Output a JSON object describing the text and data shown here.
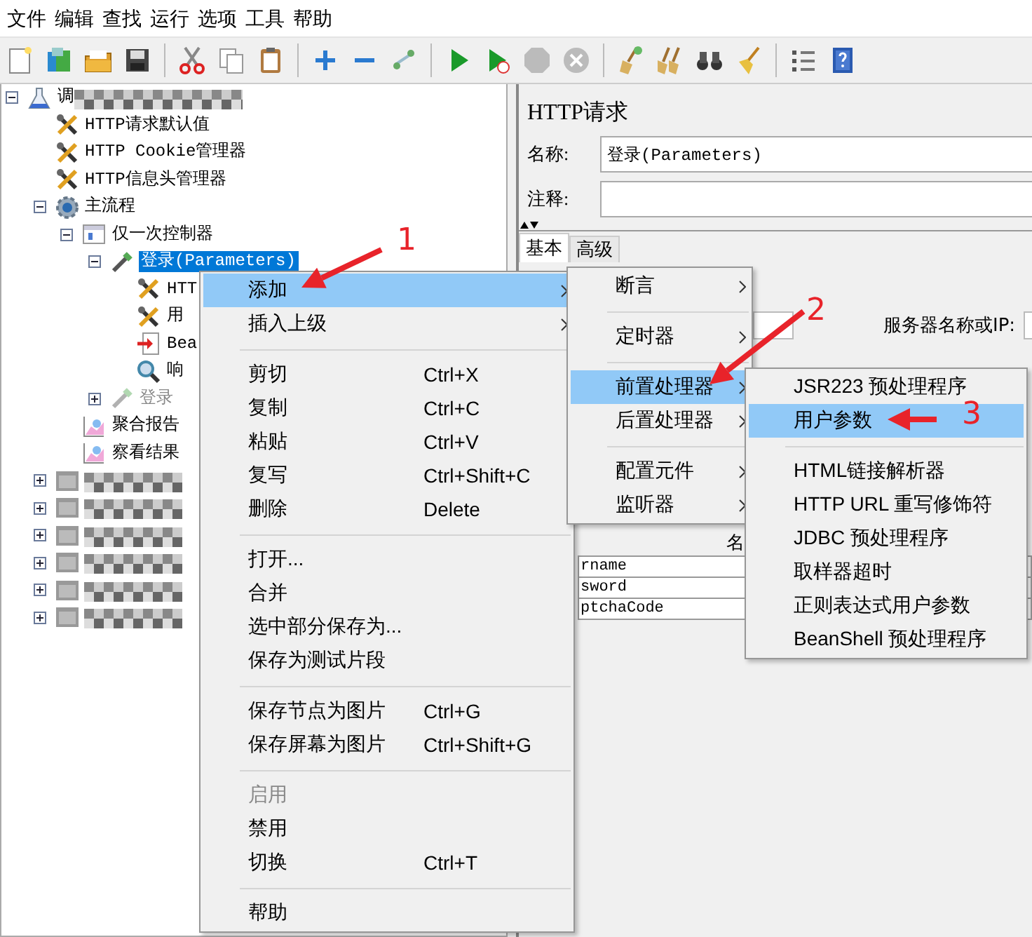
{
  "menu_bar": [
    "文件",
    "编辑",
    "查找",
    "运行",
    "选项",
    "工具",
    "帮助"
  ],
  "tree": [
    {
      "label": "调",
      "kind": "test-plan",
      "redacted": true,
      "expanded": true,
      "selected": false,
      "disabled": false,
      "children": [
        {
          "label": "HTTP请求默认值",
          "kind": "config",
          "redacted": false,
          "selected": false,
          "disabled": false
        },
        {
          "label": "HTTP Cookie管理器",
          "kind": "config",
          "redacted": false,
          "selected": false,
          "disabled": false
        },
        {
          "label": "HTTP信息头管理器",
          "kind": "config",
          "redacted": false,
          "selected": false,
          "disabled": false
        },
        {
          "label": "主流程",
          "kind": "thread-group",
          "redacted": false,
          "expanded": true,
          "selected": false,
          "disabled": false,
          "children": [
            {
              "label": "仅一次控制器",
              "kind": "controller",
              "redacted": false,
              "expanded": true,
              "selected": false,
              "disabled": false,
              "children": [
                {
                  "label": "登录(Parameters)",
                  "kind": "sampler",
                  "redacted": false,
                  "expanded": true,
                  "selected": true,
                  "disabled": false,
                  "children": [
                    {
                      "label": "HTT",
                      "kind": "config",
                      "redacted": false,
                      "selected": false,
                      "disabled": false
                    },
                    {
                      "label": "用",
                      "kind": "config",
                      "redacted": false,
                      "selected": false,
                      "disabled": false
                    },
                    {
                      "label": "Bea",
                      "kind": "postprocessor",
                      "redacted": false,
                      "selected": false,
                      "disabled": false
                    },
                    {
                      "label": "响",
                      "kind": "listener",
                      "redacted": false,
                      "selected": false,
                      "disabled": false
                    }
                  ]
                },
                {
                  "label": "登录",
                  "kind": "sampler",
                  "redacted": false,
                  "expanded": false,
                  "selected": false,
                  "disabled": true
                }
              ]
            },
            {
              "label": "聚合报告",
              "kind": "report",
              "redacted": false,
              "selected": false,
              "disabled": false
            },
            {
              "label": "察看结果",
              "kind": "report",
              "redacted": false,
              "selected": false,
              "disabled": false
            }
          ]
        },
        {
          "kind": "controller",
          "redacted": true,
          "expanded": false,
          "selected": false,
          "disabled": false
        },
        {
          "kind": "controller",
          "redacted": true,
          "expanded": false,
          "selected": false,
          "disabled": false
        },
        {
          "kind": "controller",
          "redacted": true,
          "expanded": false,
          "selected": false,
          "disabled": false
        },
        {
          "kind": "controller",
          "redacted": true,
          "expanded": false,
          "selected": false,
          "disabled": false
        },
        {
          "kind": "controller",
          "redacted": true,
          "expanded": false,
          "selected": false,
          "disabled": false
        },
        {
          "kind": "controller",
          "redacted": true,
          "expanded": false,
          "selected": false,
          "disabled": false
        }
      ]
    }
  ],
  "detail": {
    "title": "HTTP请求",
    "name_label": "名称:",
    "name_value": "登录(Parameters)",
    "comment_label": "注释:",
    "tabs": [
      {
        "label": "基本",
        "selected": true
      },
      {
        "label": "高级",
        "selected": false
      }
    ],
    "server_label": "服务器名称或IP:",
    "table": {
      "header": "名",
      "rows": [
        "rname",
        "sword",
        "ptchaCode"
      ]
    }
  },
  "context_menu": {
    "items": [
      {
        "kind": "item",
        "label": "添加",
        "submenu": true,
        "selected": true,
        "disabled": false
      },
      {
        "kind": "item",
        "label": "插入上级",
        "submenu": true,
        "selected": false,
        "disabled": false
      },
      {
        "kind": "separator"
      },
      {
        "kind": "item",
        "label": "剪切",
        "shortcut": "Ctrl+X",
        "submenu": false,
        "selected": false,
        "disabled": false
      },
      {
        "kind": "item",
        "label": "复制",
        "shortcut": "Ctrl+C",
        "submenu": false,
        "selected": false,
        "disabled": false
      },
      {
        "kind": "item",
        "label": "粘贴",
        "shortcut": "Ctrl+V",
        "submenu": false,
        "selected": false,
        "disabled": false
      },
      {
        "kind": "item",
        "label": "复写",
        "shortcut": "Ctrl+Shift+C",
        "submenu": false,
        "selected": false,
        "disabled": false
      },
      {
        "kind": "item",
        "label": "删除",
        "shortcut": "Delete",
        "submenu": false,
        "selected": false,
        "disabled": false
      },
      {
        "kind": "separator"
      },
      {
        "kind": "item",
        "label": "打开...",
        "submenu": false,
        "selected": false,
        "disabled": false
      },
      {
        "kind": "item",
        "label": "合并",
        "submenu": false,
        "selected": false,
        "disabled": false
      },
      {
        "kind": "item",
        "label": "选中部分保存为...",
        "submenu": false,
        "selected": false,
        "disabled": false
      },
      {
        "kind": "item",
        "label": "保存为测试片段",
        "submenu": false,
        "selected": false,
        "disabled": false
      },
      {
        "kind": "separator"
      },
      {
        "kind": "item",
        "label": "保存节点为图片",
        "shortcut": "Ctrl+G",
        "submenu": false,
        "selected": false,
        "disabled": false
      },
      {
        "kind": "item",
        "label": "保存屏幕为图片",
        "shortcut": "Ctrl+Shift+G",
        "submenu": false,
        "selected": false,
        "disabled": false
      },
      {
        "kind": "separator"
      },
      {
        "kind": "item",
        "label": "启用",
        "submenu": false,
        "selected": false,
        "disabled": true
      },
      {
        "kind": "item",
        "label": "禁用",
        "submenu": false,
        "selected": false,
        "disabled": false
      },
      {
        "kind": "item",
        "label": "切换",
        "shortcut": "Ctrl+T",
        "submenu": false,
        "selected": false,
        "disabled": false
      },
      {
        "kind": "separator"
      },
      {
        "kind": "item",
        "label": "帮助",
        "submenu": false,
        "selected": false,
        "disabled": false
      }
    ]
  },
  "add_submenu": {
    "items": [
      {
        "kind": "item",
        "label": "断言",
        "submenu": true,
        "selected": false,
        "disabled": false
      },
      {
        "kind": "separator"
      },
      {
        "kind": "item",
        "label": "定时器",
        "submenu": true,
        "selected": false,
        "disabled": false
      },
      {
        "kind": "separator"
      },
      {
        "kind": "item",
        "label": "前置处理器",
        "submenu": true,
        "selected": true,
        "disabled": false
      },
      {
        "kind": "item",
        "label": "后置处理器",
        "submenu": true,
        "selected": false,
        "disabled": false
      },
      {
        "kind": "separator"
      },
      {
        "kind": "item",
        "label": "配置元件",
        "submenu": true,
        "selected": false,
        "disabled": false
      },
      {
        "kind": "item",
        "label": "监听器",
        "submenu": true,
        "selected": false,
        "disabled": false
      }
    ]
  },
  "preprocessor_submenu": {
    "items": [
      {
        "kind": "item",
        "label": "JSR223 预处理程序",
        "submenu": false,
        "selected": false,
        "disabled": false
      },
      {
        "kind": "item",
        "label": "用户参数",
        "submenu": false,
        "selected": true,
        "disabled": false
      },
      {
        "kind": "separator"
      },
      {
        "kind": "item",
        "label": "HTML链接解析器",
        "submenu": false,
        "selected": false,
        "disabled": false
      },
      {
        "kind": "item",
        "label": "HTTP URL 重写修饰符",
        "submenu": false,
        "selected": false,
        "disabled": false
      },
      {
        "kind": "item",
        "label": "JDBC 预处理程序",
        "submenu": false,
        "selected": false,
        "disabled": false
      },
      {
        "kind": "item",
        "label": "取样器超时",
        "submenu": false,
        "selected": false,
        "disabled": false
      },
      {
        "kind": "item",
        "label": "正则表达式用户参数",
        "submenu": false,
        "selected": false,
        "disabled": false
      },
      {
        "kind": "item",
        "label": "BeanShell 预处理程序",
        "submenu": false,
        "selected": false,
        "disabled": false
      }
    ]
  },
  "annotations": [
    {
      "number": "1"
    },
    {
      "number": "2"
    },
    {
      "number": "3"
    }
  ]
}
